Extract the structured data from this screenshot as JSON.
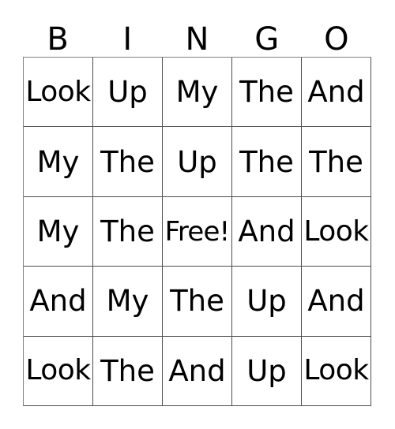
{
  "card": {
    "headers": [
      "B",
      "I",
      "N",
      "G",
      "O"
    ],
    "rows": [
      [
        "Look",
        "Up",
        "My",
        "The",
        "And"
      ],
      [
        "My",
        "The",
        "Up",
        "The",
        "The"
      ],
      [
        "My",
        "The",
        "Free!",
        "And",
        "Look"
      ],
      [
        "And",
        "My",
        "The",
        "Up",
        "And"
      ],
      [
        "Look",
        "The",
        "And",
        "Up",
        "Look"
      ]
    ],
    "free_space": {
      "label": "Free!",
      "row": 2,
      "column": 2
    },
    "colors": {
      "background": "#ffffff",
      "text": "#000000",
      "grid_line": "#4d4d4d",
      "grid_outer": "#808080"
    }
  }
}
